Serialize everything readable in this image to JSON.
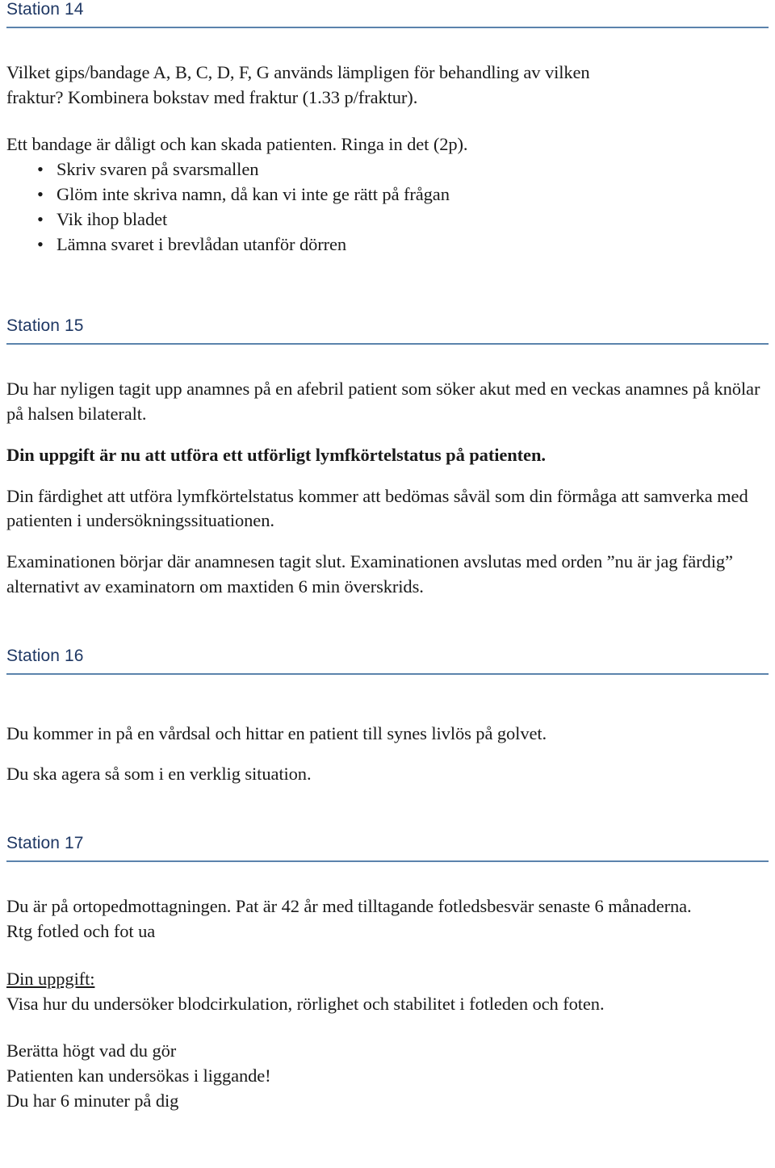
{
  "theme": {
    "heading_color": "#1F3864",
    "rule_color": "#5B83AC",
    "body_color": "#1A1A1A",
    "page_background": "#FFFFFF"
  },
  "sections": [
    {
      "heading": "Station 14",
      "intro_line_1": "Vilket gips/bandage A, B, C, D, F, G används lämpligen för behandling av vilken",
      "intro_line_2": "fraktur? Kombinera bokstav med fraktur (1.33 p/fraktur).",
      "second_paragraph": "Ett bandage är dåligt och kan skada patienten. Ringa in det (2p).",
      "bullet_marker": "•",
      "bullets": [
        "Skriv svaren på svarsmallen",
        "Glöm inte skriva namn, då kan vi inte ge rätt på frågan",
        "Vik ihop bladet",
        "Lämna svaret i brevlådan utanför dörren"
      ]
    },
    {
      "heading": "Station 15",
      "paragraph_1": "Du har nyligen tagit upp anamnes på en afebril patient som söker akut med en veckas anamnes på knölar på halsen bilateralt.",
      "paragraph_2_bold": "Din uppgift är nu att utföra ett utförligt lymfkörtelstatus på patienten.",
      "paragraph_3": "Din färdighet att utföra lymfkörtelstatus kommer att bedömas såväl som din förmåga att samverka med patienten i undersökningssituationen.",
      "paragraph_4": "Examinationen börjar där anamnesen tagit slut. Examinationen avslutas med orden ”nu är jag färdig” alternativt av examinatorn om maxtiden 6 min överskrids."
    },
    {
      "heading": "Station 16",
      "paragraph_1": "Du kommer in på en vårdsal och hittar en patient till synes livlös på golvet.",
      "paragraph_2": "Du ska agera så som i en verklig situation."
    },
    {
      "heading": "Station 17",
      "paragraph_1": "Du är på ortopedmottagningen. Pat är 42 år med tilltagande fotledsbesvär senaste 6 månaderna.",
      "paragraph_2": "Rtg fotled och fot ua",
      "task_label": "Din uppgift:",
      "task_text": "Visa hur du undersöker blodcirkulation, rörlighet och stabilitet i fotleden och foten.",
      "closing_line_1": "Berätta högt vad du gör",
      "closing_line_2": "Patienten kan undersökas i liggande!",
      "closing_line_3": "Du har 6 minuter på dig"
    }
  ]
}
